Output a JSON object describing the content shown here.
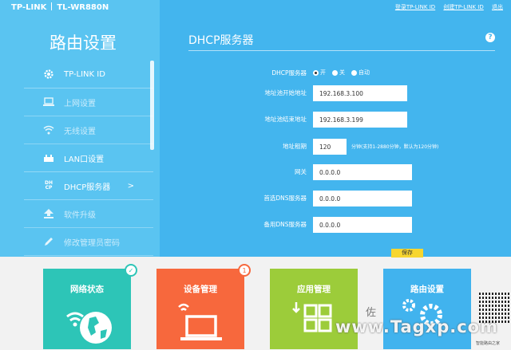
{
  "header": {
    "brand": "TP-LINK",
    "model": "TL-WR880N",
    "links": [
      "登录TP-LINK ID",
      "创建TP-LINK ID",
      "退出"
    ]
  },
  "sidebar": {
    "title": "路由设置",
    "items": [
      {
        "label": "TP-LINK ID",
        "icon": "gear-icon"
      },
      {
        "label": "上网设置",
        "icon": "laptop-icon"
      },
      {
        "label": "无线设置",
        "icon": "wifi-icon"
      },
      {
        "label": "LAN口设置",
        "icon": "router-icon"
      },
      {
        "label": "DHCP服务器",
        "icon": "dhcp-icon",
        "arrow": ">",
        "icon_text": "DH CP"
      },
      {
        "label": "软件升级",
        "icon": "upload-icon"
      },
      {
        "label": "修改管理员密码",
        "icon": "pen-icon"
      }
    ]
  },
  "panel": {
    "title": "DHCP服务器",
    "help": "?",
    "dhcp_label": "DHCP服务器",
    "options": [
      "开",
      "关",
      "自动"
    ],
    "selected": "开",
    "start_label": "地址池开始地址",
    "start_value": "192.168.3.100",
    "end_label": "地址池结束地址",
    "end_value": "192.168.3.199",
    "lease_label": "地址租期",
    "lease_value": "120",
    "lease_hint": "分钟(支持1-2880分钟，默认为120分钟)",
    "gateway_label": "网关",
    "gateway_value": "0.0.0.0",
    "dns1_label": "首选DNS服务器",
    "dns1_value": "0.0.0.0",
    "dns2_label": "备用DNS服务器",
    "dns2_value": "0.0.0.0",
    "save_label": "保存"
  },
  "tiles": [
    {
      "label": "网络状态",
      "color": "#2dc5b7",
      "badge": "✓",
      "badge_color": "#2dc5b7"
    },
    {
      "label": "设备管理",
      "color": "#f7683d",
      "badge": "1",
      "badge_color": "#f7683d"
    },
    {
      "label": "应用管理",
      "color": "#9ccc3a"
    },
    {
      "label": "路由设置",
      "color": "#41b3ee"
    }
  ],
  "watermark": {
    "text": "www.Tagxp.com",
    "sub": "佐",
    "qr_caption": "智能路由之家"
  }
}
